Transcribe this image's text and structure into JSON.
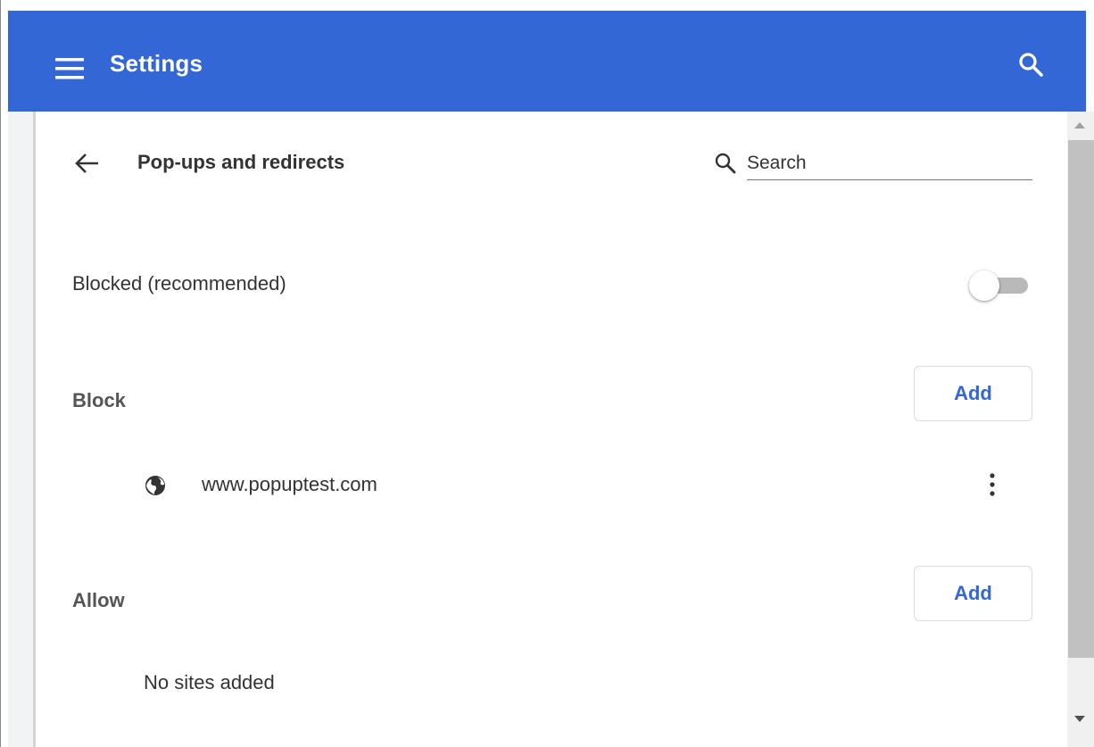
{
  "app": {
    "title": "Settings",
    "brand_color": "#3367d6",
    "menu_icon": "menu-icon",
    "search_icon": "search-icon"
  },
  "subpage": {
    "title": "Pop-ups and redirects",
    "back_icon": "arrow-back-icon",
    "search_placeholder": "Search"
  },
  "blocked_setting": {
    "label": "Blocked (recommended)",
    "enabled": false
  },
  "sections": {
    "block": {
      "label": "Block",
      "add_label": "Add",
      "sites": [
        {
          "name": "www.popuptest.com",
          "icon": "globe-icon",
          "menu_icon": "more-vert-icon"
        }
      ]
    },
    "allow": {
      "label": "Allow",
      "add_label": "Add",
      "empty_text": "No sites added"
    }
  }
}
